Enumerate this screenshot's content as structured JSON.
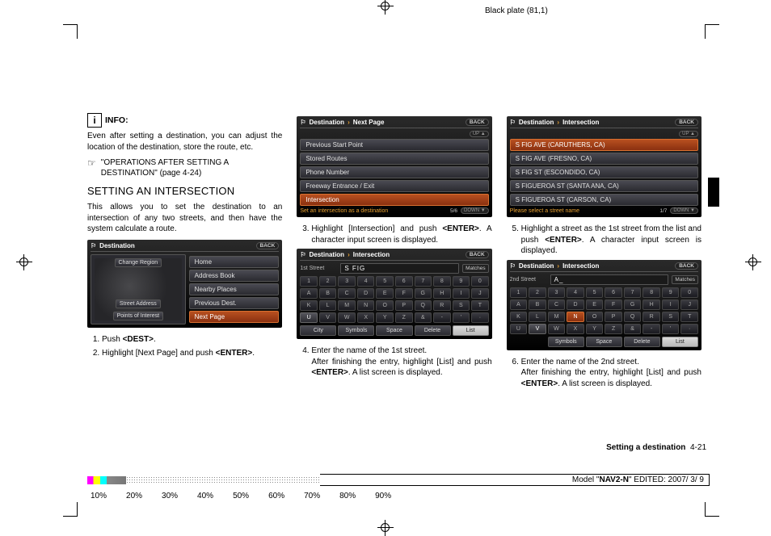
{
  "header": {
    "plate": "Black plate (81,1)"
  },
  "info": {
    "label": "INFO:",
    "text": "Even after setting a destination, you can adjust the location of the destination, store the route, etc.",
    "ref": "\"OPERATIONS AFTER SETTING A DESTINATION\" (page 4-24)"
  },
  "section_title": "SETTING AN INTERSECTION",
  "section_intro": "This allows you to set the destination to an intersection of any two streets, and then have the system calculate a route.",
  "steps": {
    "s1": "Push <DEST>.",
    "s2": "Highlight [Next Page] and push <ENTER>.",
    "s3": "Highlight [Intersection] and push <ENTER>. A character input screen is displayed.",
    "s4": "Enter the name of the 1st street. After finishing the entry, highlight [List] and push <ENTER>. A list screen is displayed.",
    "s5": "Highlight a street as the 1st street from the list and push <ENTER>. A character input screen is displayed.",
    "s6": "Enter the name of the 2nd street. After finishing the entry, highlight [List] and push <ENTER>. A list screen is displayed."
  },
  "nav1": {
    "title": "Destination",
    "back": "BACK",
    "left_top": "Change Region",
    "left_mid": "Street Address",
    "left_bot": "Points of Interest",
    "r1": "Home",
    "r2": "Address Book",
    "r3": "Nearby Places",
    "r4": "Previous Dest.",
    "r5": "Next Page"
  },
  "nav2": {
    "title1": "Destination",
    "title2": "Next Page",
    "back": "BACK",
    "r1": "Previous Start Point",
    "r2": "Stored Routes",
    "r3": "Phone Number",
    "r4": "Freeway Entrance / Exit",
    "r5": "Intersection",
    "count": "5/6",
    "footer_msg": "Set an intersection as a destination"
  },
  "nav3": {
    "title1": "Destination",
    "title2": "Intersection",
    "back": "BACK",
    "input_label": "1st Street",
    "input_value": "S FIG",
    "match": "Matches",
    "btn_city": "City",
    "btn_sym": "Symbols",
    "btn_space": "Space",
    "btn_del": "Delete",
    "btn_list": "List"
  },
  "nav4": {
    "title1": "Destination",
    "title2": "Intersection",
    "back": "BACK",
    "r1": "S FIG AVE (CARUTHERS, CA)",
    "r2": "S FIG AVE (FRESNO, CA)",
    "r3": "S FIG ST (ESCONDIDO, CA)",
    "r4": "S FIGUEROA ST (SANTA ANA, CA)",
    "r5": "S FIGUEROA ST (CARSON, CA)",
    "count": "1/7",
    "footer_msg": "Please select a street name"
  },
  "nav5": {
    "title1": "Destination",
    "title2": "Intersection",
    "back": "BACK",
    "input_label": "2nd Street",
    "input_value": "A_",
    "match": "Matches",
    "btn_sym": "Symbols",
    "btn_space": "Space",
    "btn_del": "Delete",
    "btn_list": "List"
  },
  "keys": {
    "row1": [
      "1",
      "2",
      "3",
      "4",
      "5",
      "6",
      "7",
      "8",
      "9",
      "0"
    ],
    "row2": [
      "A",
      "B",
      "C",
      "D",
      "E",
      "F",
      "G",
      "H",
      "I",
      "J"
    ],
    "row3": [
      "K",
      "L",
      "M",
      "N",
      "O",
      "P",
      "Q",
      "R",
      "S",
      "T"
    ],
    "row4": [
      "U",
      "V",
      "W",
      "X",
      "Y",
      "Z",
      "&",
      "-",
      "'",
      "·"
    ]
  },
  "footer": {
    "section": "Setting a destination",
    "page": "4-21",
    "model": "Model \"NAV2-N\" EDITED: 2007/ 3/ 9"
  },
  "percents": [
    "10%",
    "20%",
    "30%",
    "40%",
    "50%",
    "60%",
    "70%",
    "80%",
    "90%"
  ]
}
